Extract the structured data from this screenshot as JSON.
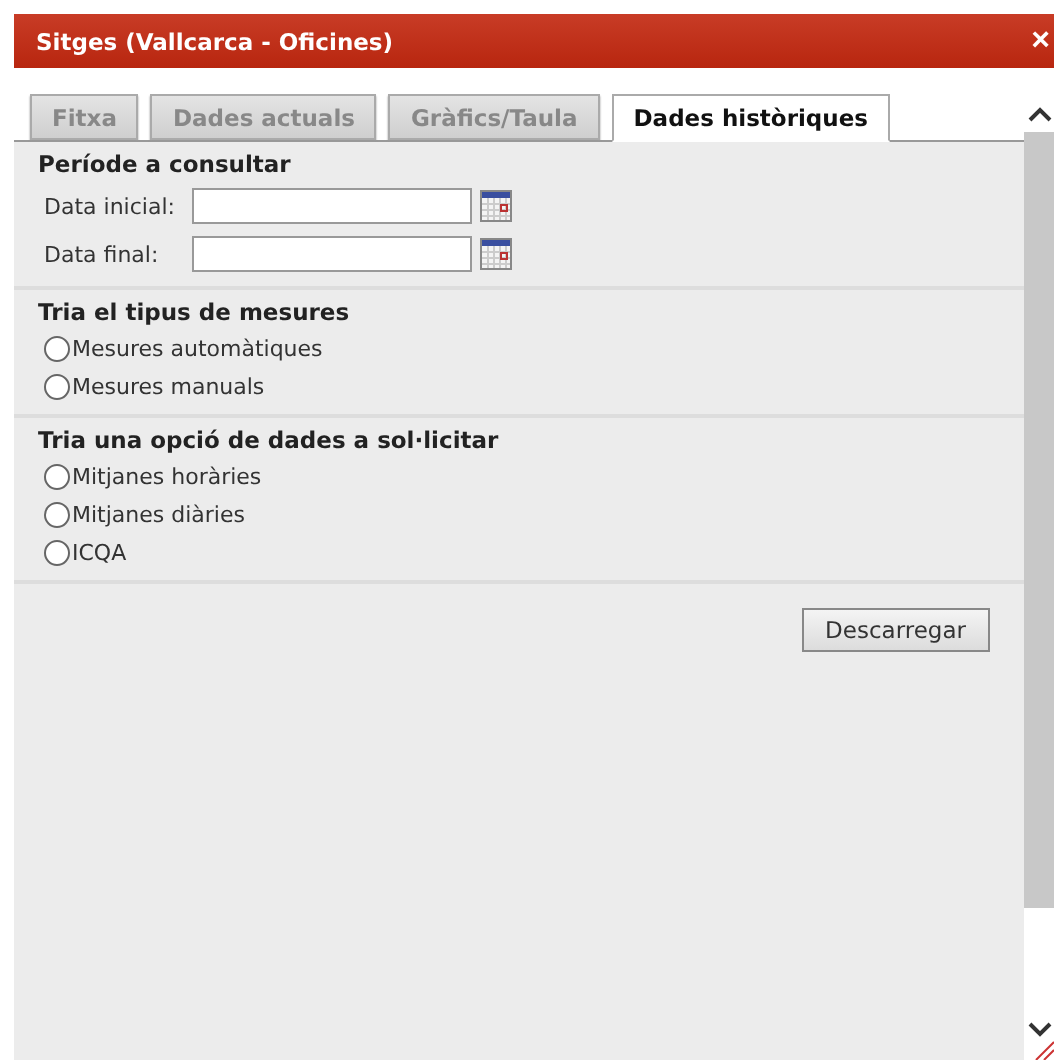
{
  "window": {
    "title": "Sitges (Vallcarca - Oficines)",
    "close": "×"
  },
  "tabs": [
    {
      "label": "Fitxa",
      "selected": false
    },
    {
      "label": "Dades actuals",
      "selected": false
    },
    {
      "label": "Gràfics/Taula",
      "selected": false
    },
    {
      "label": "Dades històriques",
      "selected": true
    }
  ],
  "period": {
    "heading": "Període a consultar",
    "fields": [
      {
        "label": "Data inicial:"
      },
      {
        "label": "Data final:"
      }
    ]
  },
  "groups": [
    {
      "heading": "Tria el tipus de mesures",
      "options": [
        {
          "label": "Mesures automàtiques",
          "selected": false
        },
        {
          "label": "Mesures manuals",
          "selected": false
        }
      ]
    },
    {
      "heading": "Tria una opció de dades a sol·licitar",
      "options": [
        {
          "label": "Mitjanes horàries",
          "selected": false
        },
        {
          "label": "Mitjanes diàries",
          "selected": false
        },
        {
          "label": "ICQA",
          "selected": false
        }
      ]
    }
  ],
  "download_button": "Descarregar"
}
